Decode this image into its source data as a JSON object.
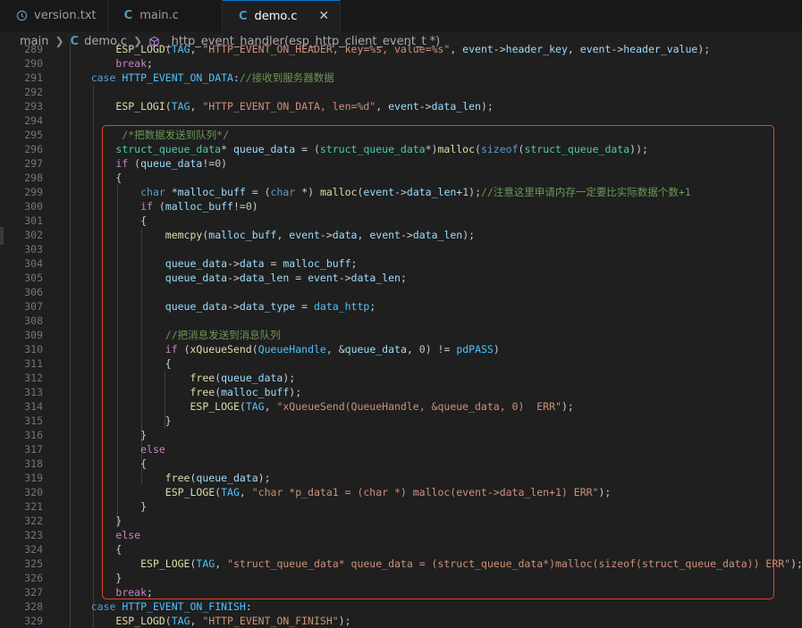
{
  "tabs": [
    {
      "label": "version.txt",
      "icon": "clock-icon",
      "active": false
    },
    {
      "label": "main.c",
      "icon": "c-language-icon",
      "active": false
    },
    {
      "label": "demo.c",
      "icon": "c-language-icon",
      "active": true
    }
  ],
  "close_glyph": "✕",
  "breadcrumb": {
    "folder": "main",
    "file": "demo.c",
    "symbol": "_http_event_handler(esp_http_client_event_t *)"
  },
  "c_glyph": "C",
  "colors": {
    "accent": "#0078d4",
    "highlight_box": "#e0452f",
    "background": "#1f1f1f"
  },
  "lines": [
    {
      "n": "289",
      "text": "        ESP_LOGD(TAG, \"HTTP_EVENT_ON_HEADER, key=%s, value=%s\", event->header_key, event->header_value);"
    },
    {
      "n": "290",
      "text": "        break;"
    },
    {
      "n": "291",
      "text": "    case HTTP_EVENT_ON_DATA://接收到服务器数据"
    },
    {
      "n": "292",
      "text": ""
    },
    {
      "n": "293",
      "text": "        ESP_LOGI(TAG, \"HTTP_EVENT_ON_DATA, len=%d\", event->data_len);"
    },
    {
      "n": "294",
      "text": ""
    },
    {
      "n": "295",
      "text": "         /*把数据发送到队列*/"
    },
    {
      "n": "296",
      "text": "        struct_queue_data* queue_data = (struct_queue_data*)malloc(sizeof(struct_queue_data));"
    },
    {
      "n": "297",
      "text": "        if (queue_data!=0)"
    },
    {
      "n": "298",
      "text": "        {"
    },
    {
      "n": "299",
      "text": "            char *malloc_buff = (char *) malloc(event->data_len+1);//注意这里申请内存一定要比实际数据个数+1"
    },
    {
      "n": "300",
      "text": "            if (malloc_buff!=0)"
    },
    {
      "n": "301",
      "text": "            {"
    },
    {
      "n": "302",
      "text": "                memcpy(malloc_buff, event->data, event->data_len);"
    },
    {
      "n": "303",
      "text": ""
    },
    {
      "n": "304",
      "text": "                queue_data->data = malloc_buff;"
    },
    {
      "n": "305",
      "text": "                queue_data->data_len = event->data_len;"
    },
    {
      "n": "306",
      "text": ""
    },
    {
      "n": "307",
      "text": "                queue_data->data_type = data_http;"
    },
    {
      "n": "308",
      "text": ""
    },
    {
      "n": "309",
      "text": "                //把消息发送到消息队列"
    },
    {
      "n": "310",
      "text": "                if (xQueueSend(QueueHandle, &queue_data, 0) != pdPASS)"
    },
    {
      "n": "311",
      "text": "                {"
    },
    {
      "n": "312",
      "text": "                    free(queue_data);"
    },
    {
      "n": "313",
      "text": "                    free(malloc_buff);"
    },
    {
      "n": "314",
      "text": "                    ESP_LOGE(TAG, \"xQueueSend(QueueHandle, &queue_data, 0)  ERR\");"
    },
    {
      "n": "315",
      "text": "                }"
    },
    {
      "n": "316",
      "text": "            }"
    },
    {
      "n": "317",
      "text": "            else"
    },
    {
      "n": "318",
      "text": "            {"
    },
    {
      "n": "319",
      "text": "                free(queue_data);"
    },
    {
      "n": "320",
      "text": "                ESP_LOGE(TAG, \"char *p_data1 = (char *) malloc(event->data_len+1) ERR\");"
    },
    {
      "n": "321",
      "text": "            }"
    },
    {
      "n": "322",
      "text": "        }"
    },
    {
      "n": "323",
      "text": "        else"
    },
    {
      "n": "324",
      "text": "        {"
    },
    {
      "n": "325",
      "text": "            ESP_LOGE(TAG, \"struct_queue_data* queue_data = (struct_queue_data*)malloc(sizeof(struct_queue_data)) ERR\");"
    },
    {
      "n": "326",
      "text": "        }"
    },
    {
      "n": "327",
      "text": "        break;"
    },
    {
      "n": "328",
      "text": "    case HTTP_EVENT_ON_FINISH:"
    },
    {
      "n": "329",
      "text": "        ESP_LOGD(TAG, \"HTTP_EVENT_ON_FINISH\");"
    }
  ]
}
